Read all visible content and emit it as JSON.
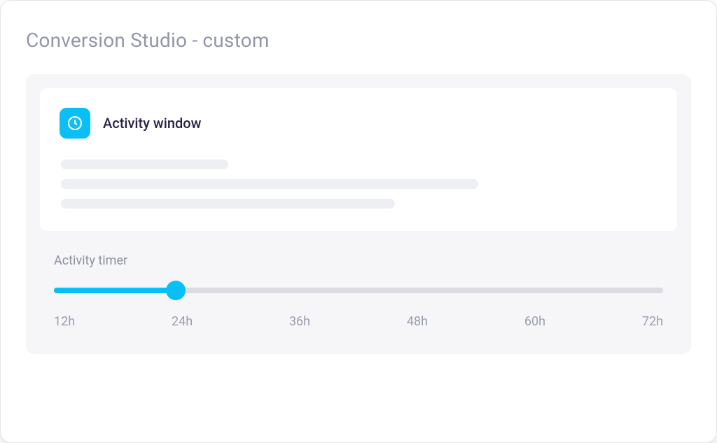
{
  "page": {
    "title": "Conversion Studio - custom"
  },
  "card": {
    "title": "Activity window"
  },
  "timer": {
    "label": "Activity timer",
    "min": 12,
    "max": 72,
    "value": 24,
    "fillPercent": "20%",
    "ticks": [
      "12h",
      "24h",
      "36h",
      "48h",
      "60h",
      "72h"
    ]
  },
  "colors": {
    "accent": "#0abff5",
    "textMuted": "#9396a9",
    "textDark": "#2b2147",
    "panelBg": "#f6f6f8",
    "skeleton": "#eeeff2",
    "trackBg": "#dadce2"
  }
}
